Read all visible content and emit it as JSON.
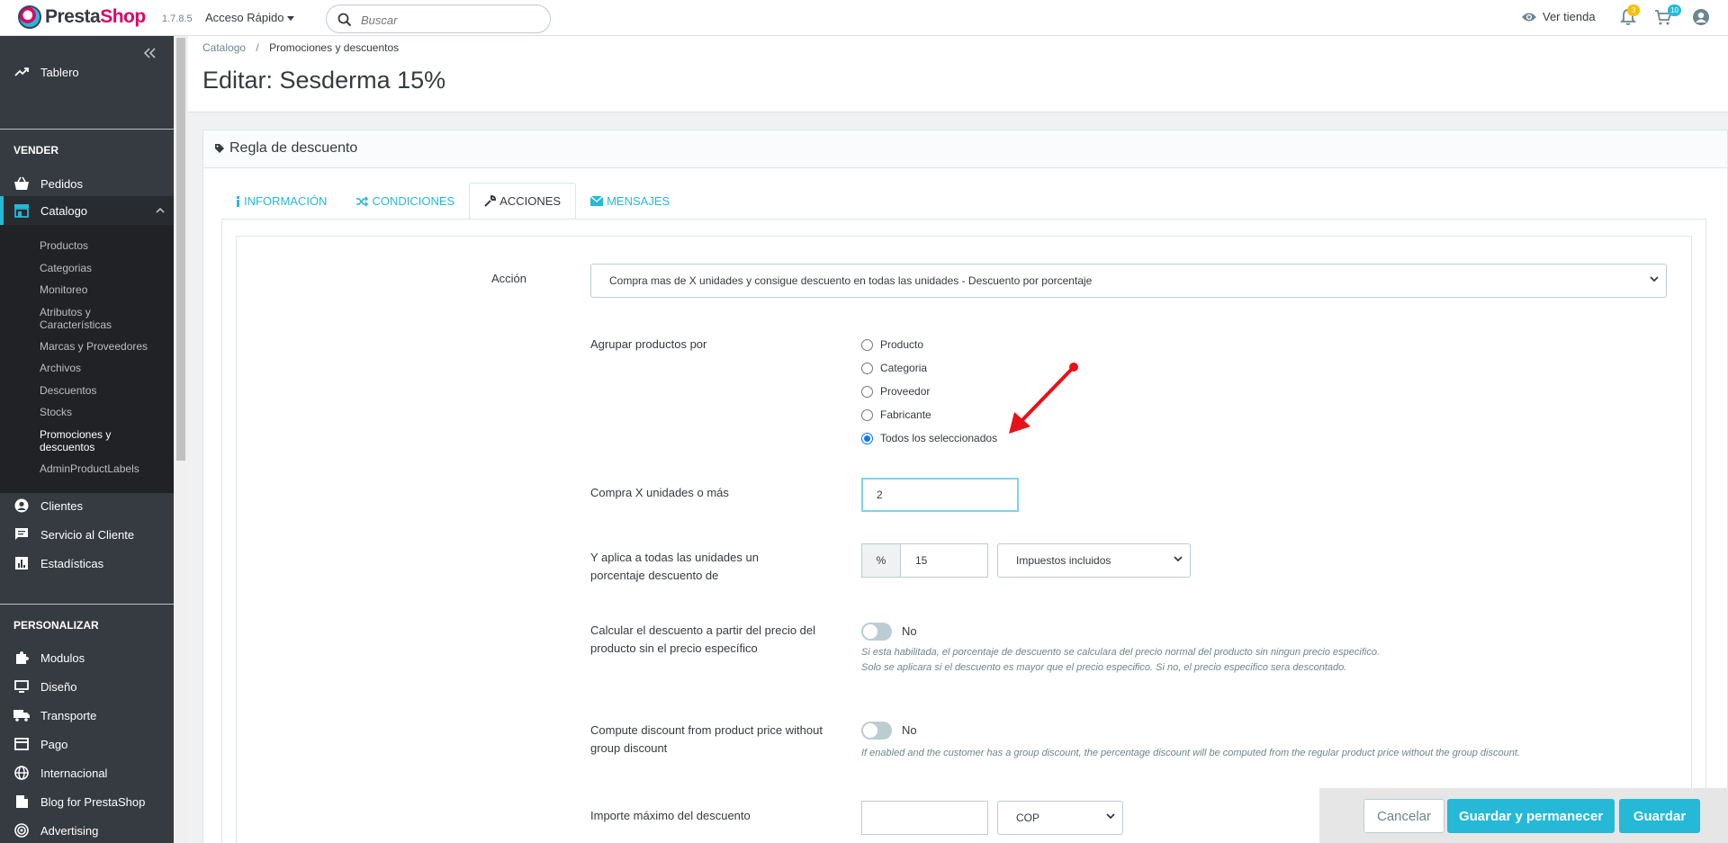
{
  "header": {
    "logo_part1": "Presta",
    "logo_part2": "Shop",
    "version": "1.7.8.5",
    "quick_access": "Acceso Rápido",
    "search_placeholder": "Buscar",
    "view_store": "Ver tienda",
    "notifications_count": "3",
    "cart_count": "10"
  },
  "sidebar": {
    "dashboard": "Tablero",
    "section_sell": "VENDER",
    "orders": "Pedidos",
    "catalog": "Catalogo",
    "catalog_sub": [
      "Productos",
      "Categorias",
      "Monitoreo",
      "Atributos y Características",
      "Marcas y Proveedores",
      "Archivos",
      "Descuentos",
      "Stocks",
      "Promociones y descuentos",
      "AdminProductLabels"
    ],
    "customers": "Clientes",
    "customer_service": "Servicio al Cliente",
    "stats": "Estadísticas",
    "section_customize": "PERSONALIZAR",
    "modules": "Modulos",
    "design": "Diseño",
    "shipping": "Transporte",
    "payment": "Pago",
    "international": "Internacional",
    "blog": "Blog for PrestaShop",
    "advertising": "Advertising"
  },
  "breadcrumb": {
    "root": "Catalogo",
    "separator": "/",
    "current": "Promociones y descuentos"
  },
  "page_title": "Editar: Sesderma 15%",
  "panel": {
    "title": "Regla de descuento",
    "tabs": [
      "INFORMACIÓN",
      "CONDICIONES",
      "ACCIONES",
      "MENSAJES"
    ],
    "active_tab": "ACCIONES"
  },
  "form": {
    "action_label": "Acción",
    "action_value": "Compra mas de X unidades y consigue descuento en todas las unidades - Descuento por porcentaje",
    "group_label": "Agrupar productos por",
    "group_options": [
      "Producto",
      "Categoria",
      "Proveedor",
      "Fabricante",
      "Todos los seleccionados"
    ],
    "group_selected": "Todos los seleccionados",
    "buy_x_label": "Compra X unidades o más",
    "buy_x_value": "2",
    "apply_label": "Y aplica a todas las unidades un porcentaje descuento de",
    "percent_addon": "%",
    "percent_value": "15",
    "tax_value": "Impuestos incluidos",
    "calc_label": "Calcular el descuento a partir del precio del producto sin el precio específico",
    "calc_toggle": "No",
    "calc_help_1": "Si esta habilitada, el porcentaje de descuento se calculara del precio normal del producto sin ningun precio especifico.",
    "calc_help_2": "Solo se aplicara si el descuento es mayor que el precio especifico. Si no, el precio especifico sera descontado.",
    "group_discount_label": "Compute discount from product price without group discount",
    "group_discount_toggle": "No",
    "group_discount_help": "If enabled and the customer has a group discount, the percentage discount will be computed from the regular product price without the group discount.",
    "max_label": "Importe máximo del descuento",
    "max_value": "",
    "currency_value": "COP"
  },
  "buttons": {
    "cancel": "Cancelar",
    "save_stay": "Guardar y permanecer",
    "save": "Guardar"
  },
  "colors": {
    "accent": "#25b9d7",
    "brand_pink": "#df0067",
    "sidebar_bg": "#363a41",
    "arrow_red": "#e8111a"
  }
}
